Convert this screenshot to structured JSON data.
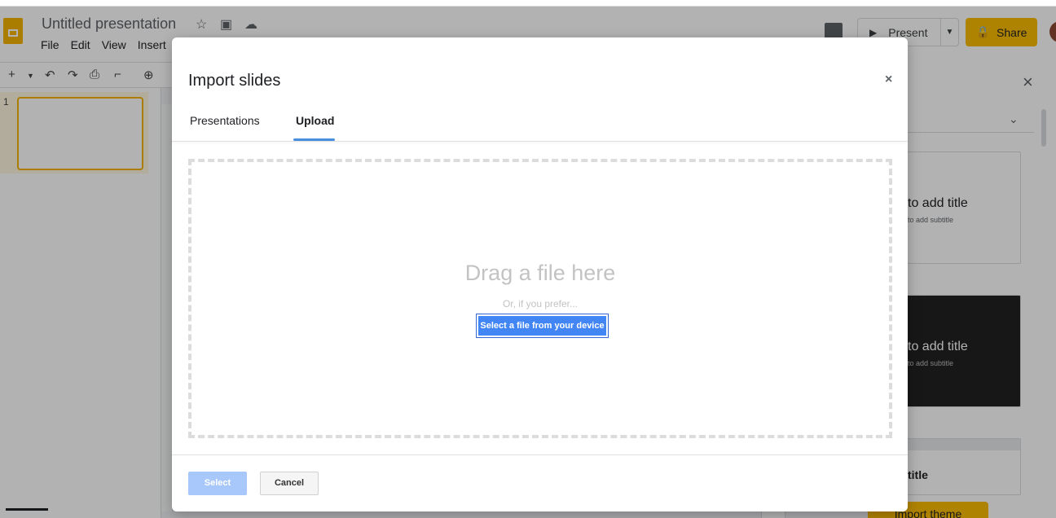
{
  "app": {
    "doc_title": "Untitled presentation",
    "menu": [
      "File",
      "Edit",
      "View",
      "Insert"
    ],
    "present_label": "Present",
    "share_label": "Share",
    "slide_number": "1",
    "import_theme_label": "Import theme"
  },
  "theme_panel": {
    "cards": [
      {
        "title": "to add title",
        "subtitle": "to add subtitle"
      },
      {
        "title": "to add title",
        "subtitle": "to add subtitle"
      },
      {
        "title": "title",
        "subtitle": ""
      }
    ]
  },
  "dialog": {
    "title": "Import slides",
    "close_glyph": "×",
    "tabs": [
      {
        "label": "Presentations",
        "active": false
      },
      {
        "label": "Upload",
        "active": true
      }
    ],
    "drop_text": "Drag a file here",
    "prefer_text": "Or, if you prefer...",
    "select_file_label": "Select a file from your device",
    "select_label": "Select",
    "cancel_label": "Cancel"
  },
  "colors": {
    "accent": "#4285f4",
    "tab_underline": "#4a90e2",
    "select_disabled": "#a8c7fa",
    "brand_yellow": "#fbbc04"
  }
}
